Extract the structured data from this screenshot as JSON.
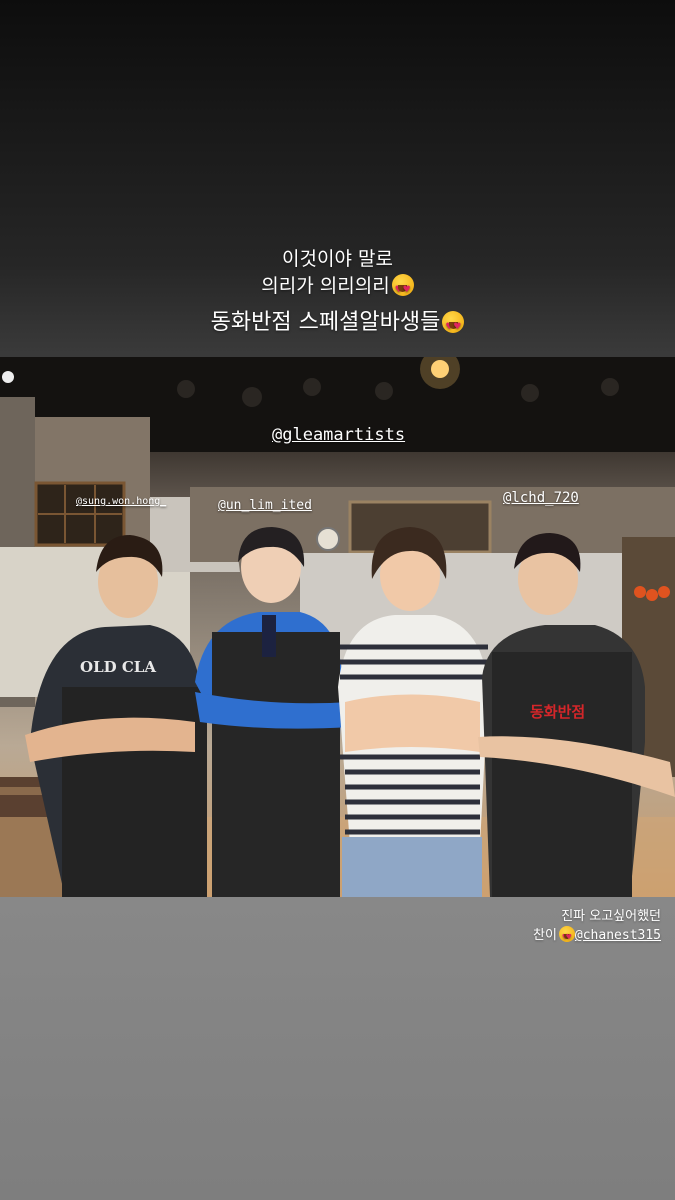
{
  "captions": {
    "line1": "이것이야 말로",
    "line2": "의리가 의리의리",
    "line3": "동화반점 스페셜알바생들"
  },
  "photo": {
    "tags": {
      "main": "@gleamartists",
      "person1": "@sung.won.hong_",
      "person2": "@un_lim_ited",
      "person3": "@lchd_720"
    },
    "apron_logo": "동화반점",
    "shirt_text": "OLD CLA"
  },
  "caption_bottom": {
    "line1": "진파 오고싶어했던",
    "line2_prefix": "찬이",
    "mention": "@chanest315"
  },
  "icons": [
    "heart-eyes-emoji"
  ],
  "colors": {
    "background_top": "#0d0d0d",
    "background_bottom": "#888888",
    "caption_text": "#ffffff"
  }
}
